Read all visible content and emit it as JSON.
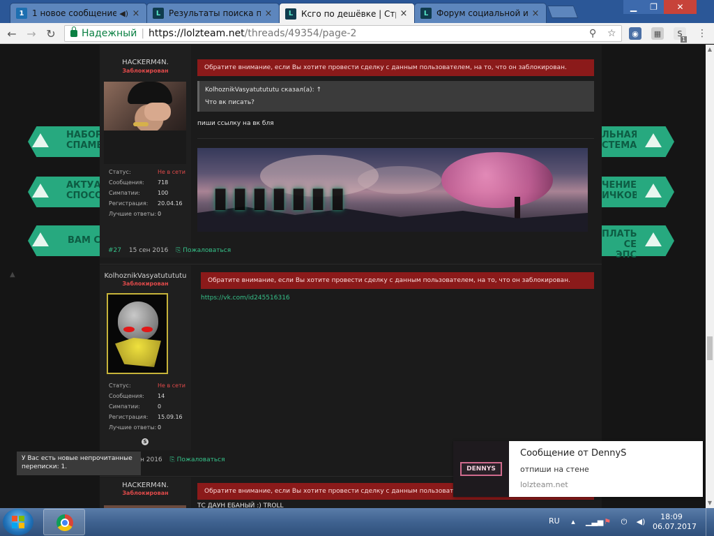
{
  "browser": {
    "tabs": [
      {
        "label": "1 новое сообщение",
        "favicon": "1",
        "has_audio": true,
        "active": false
      },
      {
        "label": "Результаты поиска по з",
        "favicon": "L",
        "has_audio": false,
        "active": false
      },
      {
        "label": "Ксго по дешёвке | Стран",
        "favicon": "L",
        "has_audio": false,
        "active": true
      },
      {
        "label": "Форум социальной инж",
        "favicon": "L",
        "has_audio": false,
        "active": false
      }
    ],
    "security_label": "Надежный",
    "url_scheme_host": "https://lolzteam.net",
    "url_path": "/threads/49354/page-2",
    "extension_badge": "1"
  },
  "banners": {
    "left": [
      "НАБОР СПАМЕ",
      "АКТУА СПОСО",
      "ВАМ СО"
    ],
    "right": [
      "ЛЬНАЯ СТЕМА",
      "ЧЕНИЕ ИЧКОВ",
      "ПЛАТЫ СЕ ЭПС"
    ]
  },
  "stat_labels": {
    "status": "Статус:",
    "messages": "Сообщения:",
    "likes": "Симпатии:",
    "registration": "Регистрация:",
    "best_answers": "Лучшие ответы:"
  },
  "posts": [
    {
      "username": "HACKERM4N.",
      "banned_label": "Заблокирован",
      "status": "Не в сети",
      "messages": "718",
      "likes": "100",
      "registration": "20.04.16",
      "best_answers": "0",
      "warning": "Обратите внимание, если Вы хотите провести сделку с данным пользователем, на то, что он заблокирован.",
      "quote_author": "KolhoznikVasyatutututu сказал(а): ↑",
      "quote_text": "Что вк писать?",
      "text": "пиши ссылку на вк бля",
      "number": "#27",
      "date": "15 сен 2016",
      "report": "Пожаловаться"
    },
    {
      "username": "KolhoznikVasyatutututu",
      "banned_label": "Заблокирован",
      "status": "Не в сети",
      "messages": "14",
      "likes": "0",
      "registration": "15.09.16",
      "best_answers": "0",
      "warning": "Обратите внимание, если Вы хотите провести сделку с данным пользователем, на то, что он заблокирован.",
      "link": "https://vk.com/id245516316",
      "date_fragment": "н 2016",
      "report": "Пожаловаться"
    },
    {
      "username": "HACKERM4N.",
      "banned_label": "Заблокирован",
      "warning": "Обратите внимание, если Вы хотите провести сделку с данным пользователем, на то",
      "text": "ТС ДАУН ЕБАНЫЙ :) TROLL"
    }
  ],
  "tooltip": "У Вас есть новые непрочитанные переписки: 1.",
  "notification": {
    "title": "Сообщение от DennyS",
    "body": "отпиши на стене",
    "source": "lolzteam.net",
    "logo_text": "DENNYS"
  },
  "taskbar": {
    "language": "RU",
    "time": "18:09",
    "date": "06.07.2017"
  },
  "colors": {
    "warning_bg": "#8b1a1a",
    "accent_green": "#36c28a",
    "banner_green": "#27a97f",
    "banned_red": "#e04a4a"
  }
}
